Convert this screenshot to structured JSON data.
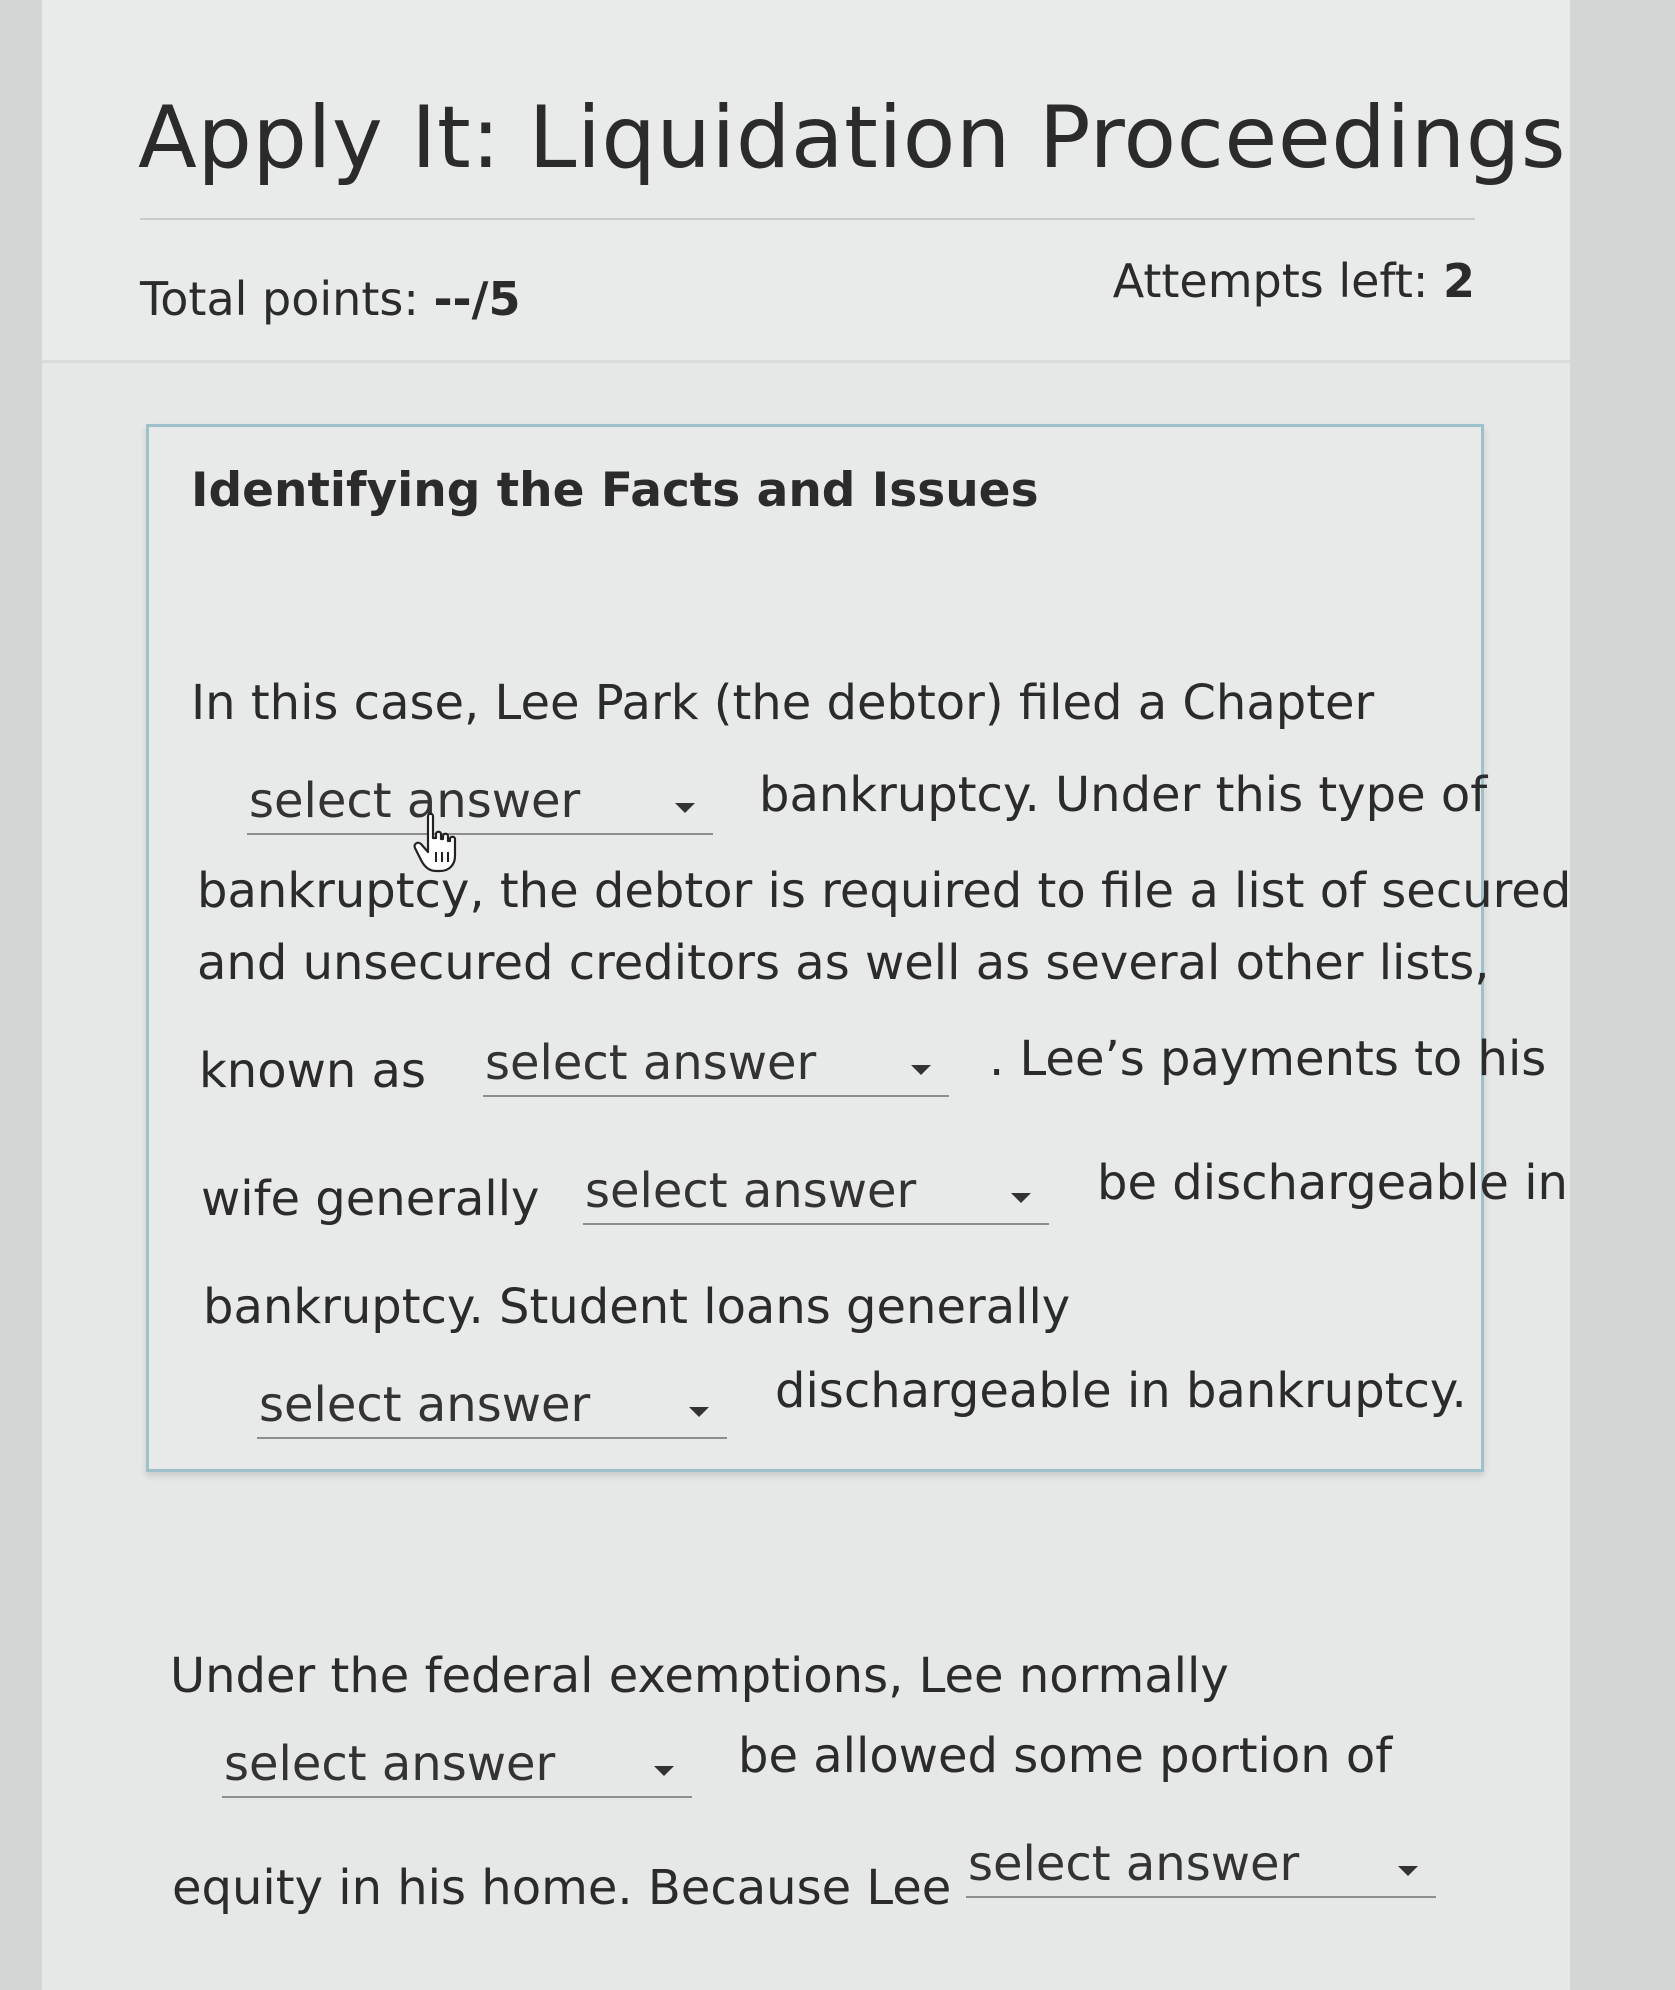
{
  "header": {
    "title": "Apply It: Liquidation Proceedings",
    "points_label": "Total points: ",
    "points_value": "--/5",
    "attempts_label": "Attempts left: ",
    "attempts_value": "2"
  },
  "card": {
    "title": "Identifying the Facts and Issues",
    "lines": [
      "In this case, Lee Park (the debtor) filed a Chapter",
      "bankruptcy. Under this type of",
      "bankruptcy, the debtor is required to file a list of secured",
      "and unsecured creditors as well as several other lists,",
      "known as",
      ". Lee’s payments to his",
      "wife generally",
      "be dischargeable in",
      "bankruptcy. Student loans generally",
      "dischargeable in bankruptcy."
    ]
  },
  "second": {
    "lines": [
      "Under the federal exemptions, Lee normally",
      "be allowed some portion of",
      "equity in his home. Because Lee"
    ]
  },
  "dropdown_placeholder": "select answer",
  "dropdowns": [
    "select answer",
    "select answer",
    "select answer",
    "select answer",
    "select answer",
    "select answer"
  ]
}
